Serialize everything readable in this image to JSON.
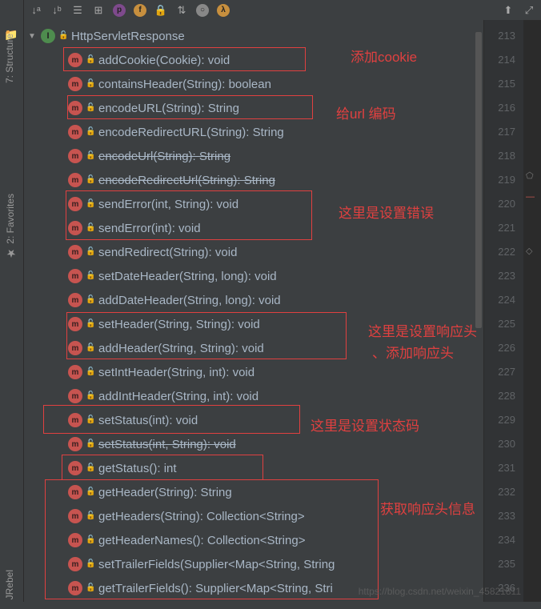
{
  "sidebar": {
    "tab_project": "1: P",
    "tab_structure": "7: Structure",
    "tab_favorites": "2: Favorites",
    "tab_jrebel": "JRebel"
  },
  "toolbar": {
    "icons": [
      "sort",
      "filter",
      "expand",
      "p",
      "f",
      "lock",
      "sort2",
      "circle",
      "lambda",
      "pin",
      "collapse"
    ]
  },
  "tree": {
    "root": "HttpServletResponse",
    "methods": [
      {
        "sig": "addCookie(Cookie): void",
        "strike": false
      },
      {
        "sig": "containsHeader(String): boolean",
        "strike": false
      },
      {
        "sig": "encodeURL(String): String",
        "strike": false
      },
      {
        "sig": "encodeRedirectURL(String): String",
        "strike": false
      },
      {
        "sig": "encodeUrl(String): String",
        "strike": true
      },
      {
        "sig": "encodeRedirectUrl(String): String",
        "strike": true
      },
      {
        "sig": "sendError(int, String): void",
        "strike": false
      },
      {
        "sig": "sendError(int): void",
        "strike": false
      },
      {
        "sig": "sendRedirect(String): void",
        "strike": false
      },
      {
        "sig": "setDateHeader(String, long): void",
        "strike": false
      },
      {
        "sig": "addDateHeader(String, long): void",
        "strike": false
      },
      {
        "sig": "setHeader(String, String): void",
        "strike": false
      },
      {
        "sig": "addHeader(String, String): void",
        "strike": false
      },
      {
        "sig": "setIntHeader(String, int): void",
        "strike": false
      },
      {
        "sig": "addIntHeader(String, int): void",
        "strike": false
      },
      {
        "sig": "setStatus(int): void",
        "strike": false
      },
      {
        "sig": "setStatus(int, String): void",
        "strike": true
      },
      {
        "sig": "getStatus(): int",
        "strike": false
      },
      {
        "sig": "getHeader(String): String",
        "strike": false
      },
      {
        "sig": "getHeaders(String): Collection<String>",
        "strike": false
      },
      {
        "sig": "getHeaderNames(): Collection<String>",
        "strike": false
      },
      {
        "sig": "setTrailerFields(Supplier<Map<String, String",
        "strike": false
      },
      {
        "sig": "getTrailerFields(): Supplier<Map<String, Stri",
        "strike": false
      }
    ]
  },
  "annotations": {
    "a1": "添加cookie",
    "a2": "给url 编码",
    "a3": "这里是设置错误",
    "a4_line1": "这里是设置响应头",
    "a4_line2": "、添加响应头",
    "a5": "这里是设置状态码",
    "a6": "获取响应头信息"
  },
  "gutter": {
    "start": 213,
    "end": 236
  },
  "watermark": "https://blog.csdn.net/weixin_45821811"
}
